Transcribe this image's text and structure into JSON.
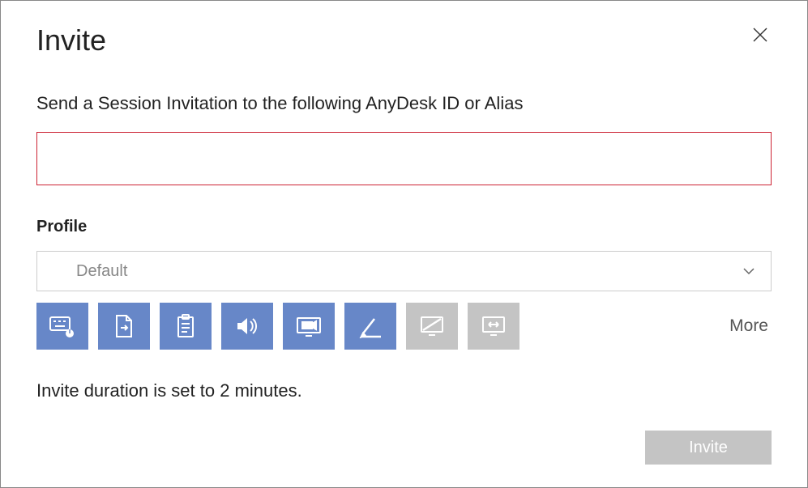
{
  "title": "Invite",
  "instruction": "Send a Session Invitation to the following AnyDesk ID or Alias",
  "destination": {
    "value": "",
    "placeholder": ""
  },
  "profile": {
    "label": "Profile",
    "selected": "Default"
  },
  "permissions": {
    "items": [
      {
        "name": "control-input-icon",
        "enabled": true
      },
      {
        "name": "file-transfer-icon",
        "enabled": true
      },
      {
        "name": "clipboard-icon",
        "enabled": true
      },
      {
        "name": "audio-icon",
        "enabled": true
      },
      {
        "name": "record-session-icon",
        "enabled": true
      },
      {
        "name": "whiteboard-icon",
        "enabled": true
      },
      {
        "name": "block-input-icon",
        "enabled": false
      },
      {
        "name": "switch-sides-icon",
        "enabled": false
      }
    ],
    "more_label": "More"
  },
  "duration_text": "Invite duration is set to 2 minutes.",
  "invite_button": "Invite"
}
